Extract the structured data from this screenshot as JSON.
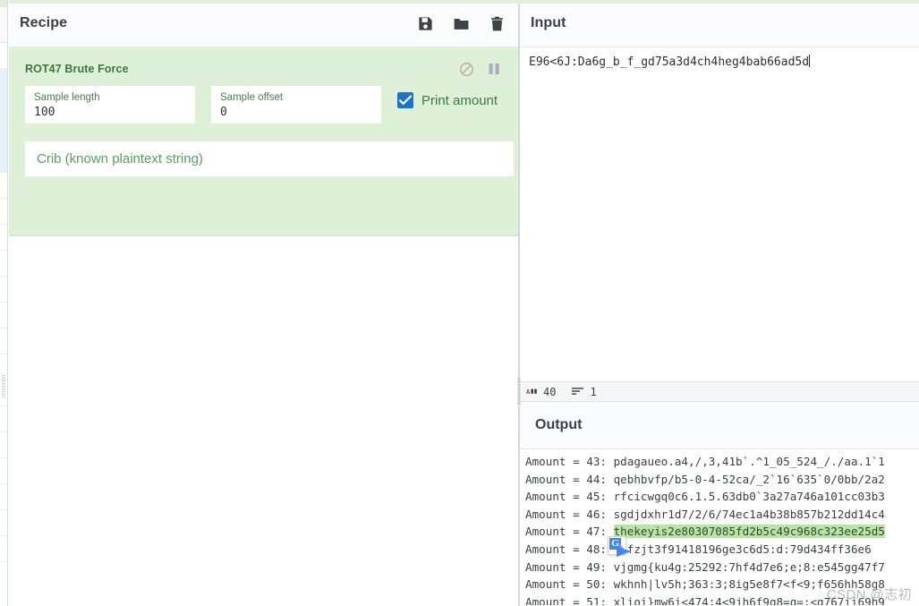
{
  "app": {
    "name": "CyberChef",
    "theme_accent": "#dff0d8",
    "highlight_color": "#b7e6a4",
    "checkbox_color": "#1a73cc",
    "op_title_color": "#3c763d"
  },
  "recipe": {
    "title": "Recipe",
    "title_icons": [
      {
        "name": "save-icon",
        "label": "Save recipe"
      },
      {
        "name": "folder-icon",
        "label": "Load recipe"
      },
      {
        "name": "trash-icon",
        "label": "Clear recipe"
      }
    ],
    "operation": {
      "name": "ROT47 Brute Force",
      "icons": [
        {
          "name": "disable-icon",
          "label": "Disable operation"
        },
        {
          "name": "pause-icon",
          "label": "Set breakpoint"
        }
      ],
      "args": [
        {
          "label": "Sample length",
          "value": "100"
        },
        {
          "label": "Sample offset",
          "value": "0"
        }
      ],
      "checkbox": {
        "label": "Print amount",
        "checked": true
      },
      "crib": {
        "placeholder": "Crib (known plaintext string)",
        "value": ""
      }
    }
  },
  "input": {
    "title": "Input",
    "value": "E96<6J:Da6g_b_f_gd75a3d4ch4heg4bab66ad5d",
    "status": {
      "length_icon": "abc-icon",
      "length": "40",
      "lines_icon": "lines-icon",
      "lines": "1"
    }
  },
  "output": {
    "title": "Output",
    "lines": [
      {
        "prefix": "Amount = 43: ",
        "text": "pdagaueo.a4,/,3,41b`.^1_05_524_/./aa.1`1",
        "highlight": false
      },
      {
        "prefix": "Amount = 44: ",
        "text": "qebhbvfp/b5-0-4-52ca/_2`16`635`0/0bb/2a2",
        "highlight": false
      },
      {
        "prefix": "Amount = 45: ",
        "text": "rfcicwgq0c6.1.5.63db0`3a27a746a101cc03b3",
        "highlight": false
      },
      {
        "prefix": "Amount = 46: ",
        "text": "sgdjdxhr1d7/2/6/74ec1a4b38b857b212dd14c4",
        "highlight": false
      },
      {
        "prefix": "Amount = 47: ",
        "text": "thekeyis2e80307085fd2b5c49c968c323ee25d5",
        "highlight": true
      },
      {
        "prefix": "Amount = 48: ",
        "text": "flfzjt3f91418196ge3c6d5:d:79d434ff36e6",
        "highlight": false
      },
      {
        "prefix": "Amount = 49: ",
        "text": "vjgmg{ku4g:25292:7hf4d7e6;e;8:e545gg47f7",
        "highlight": false
      },
      {
        "prefix": "Amount = 50: ",
        "text": "wkhnh|lv5h;363:3;8ig5e8f7<f<9;f656hh58g8",
        "highlight": false
      },
      {
        "prefix": "Amount = 51: ",
        "text": "xlioi}mw6i<474;4<9jh6f9g8=g=:<g767ii69h9",
        "highlight": false
      }
    ],
    "overlay_icon": "google-translate-icon"
  },
  "watermark": "CSDN @志初"
}
